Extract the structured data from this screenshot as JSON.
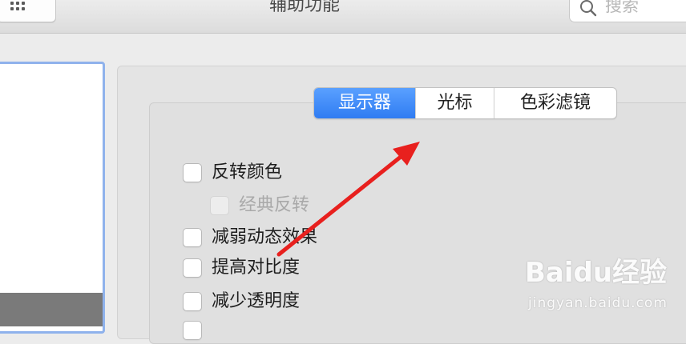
{
  "window": {
    "title": "辅助功能"
  },
  "search": {
    "placeholder": "搜索"
  },
  "tabs": [
    {
      "label": "显示器",
      "active": true
    },
    {
      "label": "光标",
      "active": false
    },
    {
      "label": "色彩滤镜",
      "active": false
    }
  ],
  "options": [
    {
      "label": "反转颜色",
      "checked": false,
      "disabled": false
    },
    {
      "label": "经典反转",
      "checked": false,
      "disabled": true
    },
    {
      "label": "减弱动态效果",
      "checked": false,
      "disabled": false
    },
    {
      "label": "提高对比度",
      "checked": false,
      "disabled": false
    },
    {
      "label": "减少透明度",
      "checked": false,
      "disabled": false
    }
  ],
  "watermark": {
    "brand": "Baidu经验",
    "url": "jingyan.baidu.com"
  },
  "colors": {
    "accent": "#2f7cf2",
    "annotation_arrow": "#e8201e"
  }
}
